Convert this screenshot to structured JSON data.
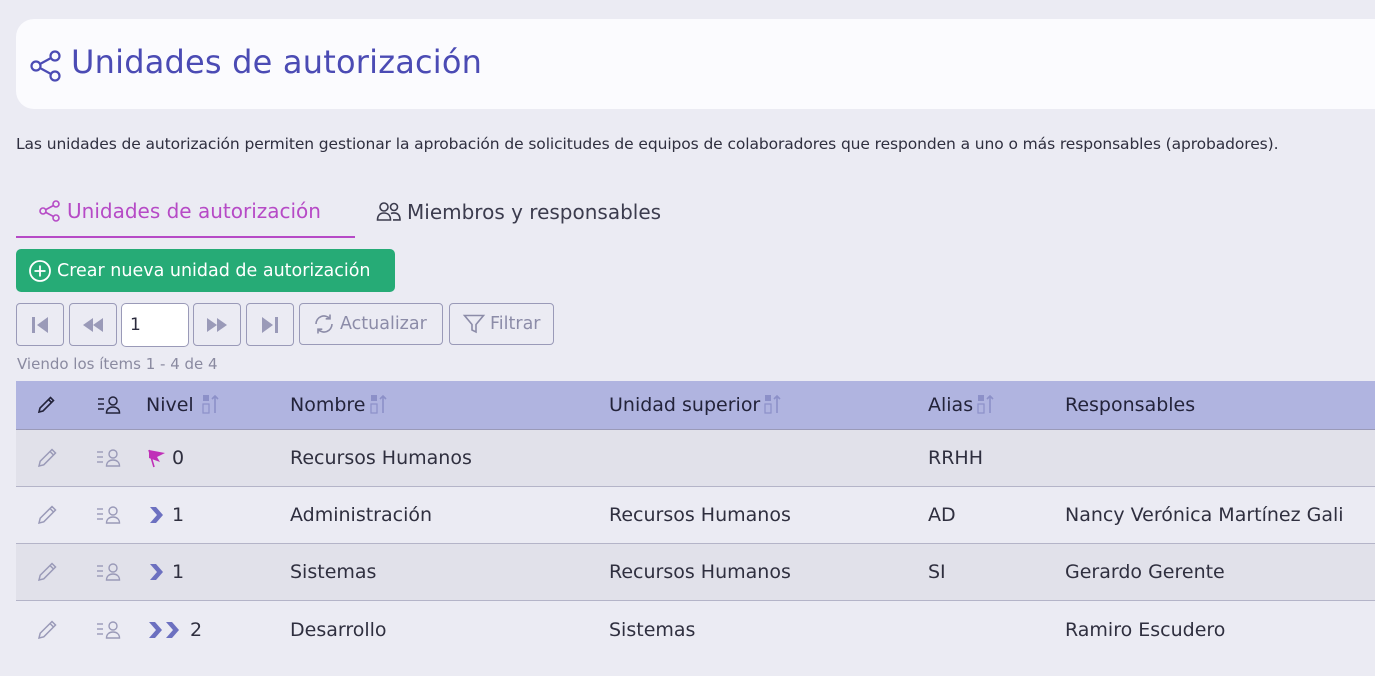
{
  "header": {
    "title": "Unidades de autorización",
    "icon": "share-nodes-icon"
  },
  "description": "Las unidades de autorización permiten gestionar la aprobación de solicitudes de equipos de colaboradores que responden a uno o más responsables (aprobadores).",
  "tabs": [
    {
      "label": "Unidades de autorización",
      "icon": "share-nodes-icon",
      "active": true
    },
    {
      "label": "Miembros y responsables",
      "icon": "users-icon",
      "active": false
    }
  ],
  "toolbar": {
    "create_label": "Crear nueva unidad de autorización",
    "page_value": "1",
    "refresh_label": "Actualizar",
    "filter_label": "Filtrar",
    "item_count": "Viendo los ítems 1 - 4  de  4"
  },
  "table": {
    "columns": [
      "Nivel",
      "Nombre",
      "Unidad superior",
      "Alias",
      "Responsables"
    ],
    "rows": [
      {
        "level": "0",
        "level_icon": "flag-icon",
        "name": "Recursos Humanos",
        "parent": "",
        "alias": "RRHH",
        "responsables": ""
      },
      {
        "level": "1",
        "level_icon": "chevron-right-icon",
        "name": "Administración",
        "parent": "Recursos Humanos",
        "alias": "AD",
        "responsables": "Nancy Verónica Martínez Gali"
      },
      {
        "level": "1",
        "level_icon": "chevron-right-icon",
        "name": "Sistemas",
        "parent": "Recursos Humanos",
        "alias": "SI",
        "responsables": "Gerardo Gerente"
      },
      {
        "level": "2",
        "level_icon": "double-chevron-right-icon",
        "name": "Desarrollo",
        "parent": "Sistemas",
        "alias": "",
        "responsables": "Ramiro Escudero"
      }
    ]
  },
  "colors": {
    "accent": "#4b4bb4",
    "tab_active": "#b64ac6",
    "primary_button": "#26ab76",
    "table_header": "#b0b4e0"
  }
}
